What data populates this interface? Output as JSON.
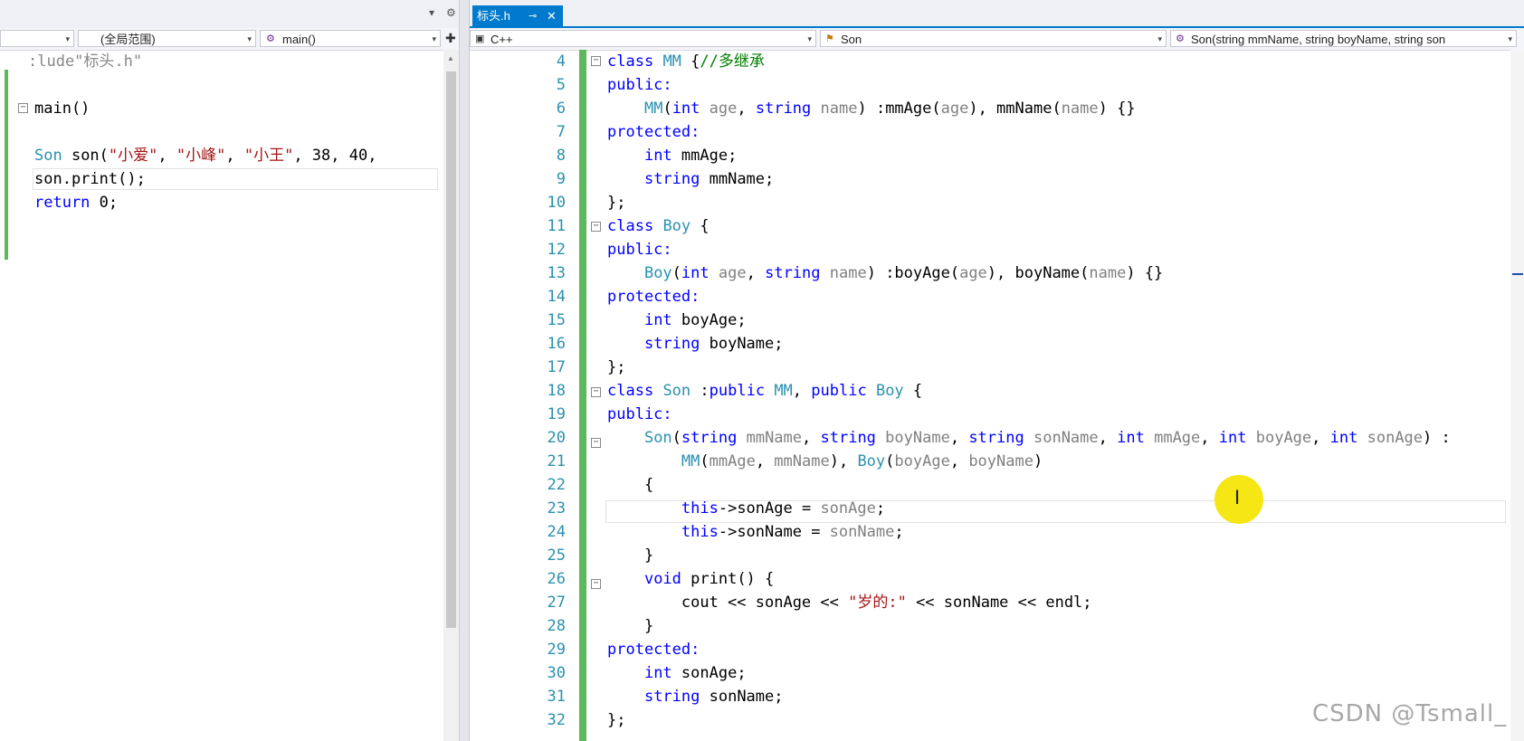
{
  "left_editor": {
    "nav": {
      "scope_left": "",
      "scope_mid": "(全局范围)",
      "scope_right": "main()"
    },
    "lines": [
      ":lude\"标头.h\"",
      "",
      "main()",
      "",
      "Son son(\"小爱\", \"小峰\", \"小王\", 38, 40, ",
      "son.print();",
      "return 0;"
    ]
  },
  "right_editor": {
    "tab": {
      "title": "标头.h",
      "pin_icon": "pin-icon",
      "close_icon": "close-icon"
    },
    "nav": {
      "project": "C++",
      "class": "Son",
      "member": "Son(string mmName, string boyName, string son"
    },
    "line_numbers": [
      "4",
      "5",
      "6",
      "7",
      "8",
      "9",
      "10",
      "11",
      "12",
      "13",
      "14",
      "15",
      "16",
      "17",
      "18",
      "19",
      "20",
      "21",
      "22",
      "23",
      "24",
      "25",
      "26",
      "27",
      "28",
      "29",
      "30",
      "31",
      "32"
    ]
  },
  "watermark": "CSDN @Tsmall_"
}
